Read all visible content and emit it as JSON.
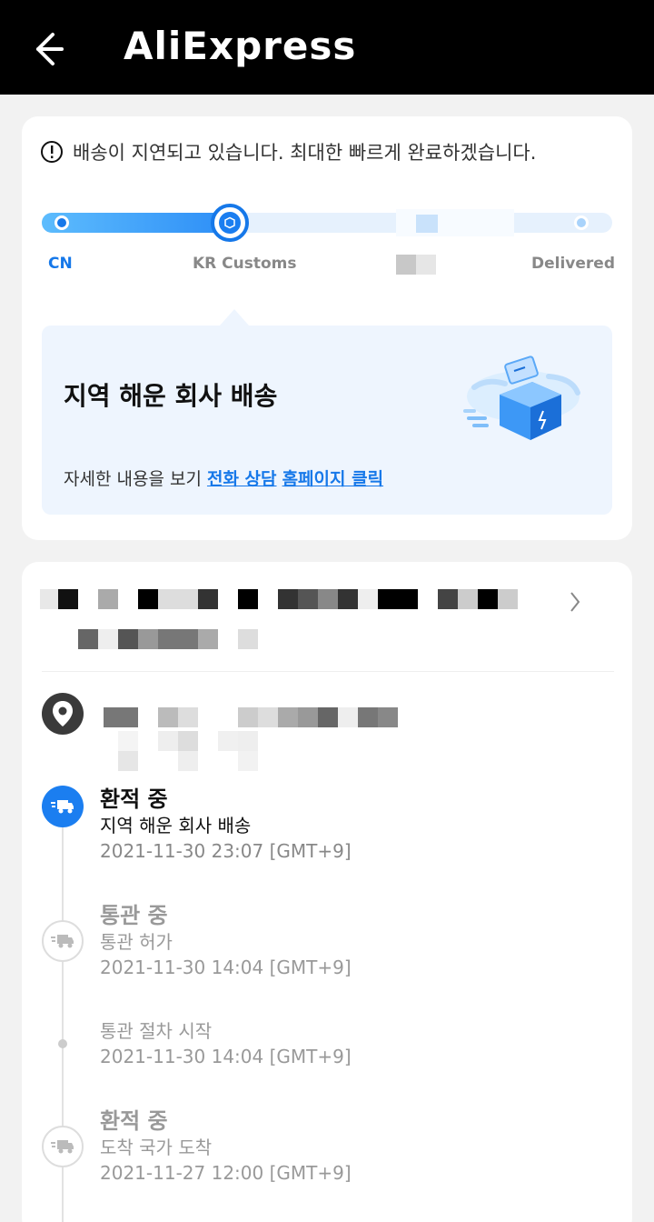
{
  "header": {
    "title": "AliExpress"
  },
  "notice": {
    "text": "배송이 지연되고 있습니다. 최대한 빠르게 완료하겠습니다."
  },
  "progress": {
    "stages": [
      "CN",
      "KR Customs",
      "Delivered"
    ],
    "active_index": 1,
    "fill_fraction": 0.33
  },
  "info": {
    "title": "지역 해운 회사 배송",
    "sub_prefix": "자세한 내용을 보기 ",
    "link1": "전화 상담",
    "link2": "홈페이지 클릭"
  },
  "timeline": [
    {
      "title": "환적 중",
      "desc": "지역 해운 회사 배송",
      "time": "2021-11-30 23:07 [GMT+9]",
      "state": "active"
    },
    {
      "title": "통관 중",
      "desc": "통관 허가",
      "time": "2021-11-30 14:04 [GMT+9]",
      "state": "past"
    },
    {
      "title": "",
      "desc": "통관 절차 시작",
      "time": "2021-11-30 14:04 [GMT+9]",
      "state": "sub"
    },
    {
      "title": "환적 중",
      "desc": "도착 국가 도착",
      "time": "2021-11-27 12:00 [GMT+9]",
      "state": "past"
    }
  ],
  "colors": {
    "accent": "#1678e9",
    "header_bg": "#000000"
  }
}
